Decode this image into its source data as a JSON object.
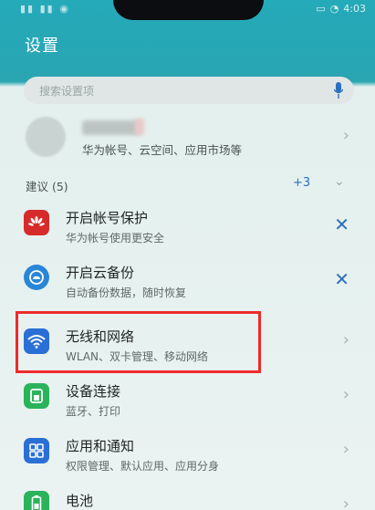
{
  "status": {
    "time": "4:03"
  },
  "header": {
    "title": "设置"
  },
  "search": {
    "placeholder": "搜索设置项"
  },
  "account": {
    "subtitle": "华为帐号、云空间、应用市场等"
  },
  "suggestions": {
    "label": "建议 (5)",
    "count": "+3"
  },
  "rows": [
    {
      "title": "开启帐号保护",
      "subtitle": "华为帐号使用更安全",
      "icon": "huawei-icon",
      "action": "close"
    },
    {
      "title": "开启云备份",
      "subtitle": "自动备份数据，随时恢复",
      "icon": "cloud-backup-icon",
      "action": "close"
    },
    {
      "title": "无线和网络",
      "subtitle": "WLAN、双卡管理、移动网络",
      "icon": "wifi-icon",
      "action": "chevron"
    },
    {
      "title": "设备连接",
      "subtitle": "蓝牙、打印",
      "icon": "device-connection-icon",
      "action": "chevron"
    },
    {
      "title": "应用和通知",
      "subtitle": "权限管理、默认应用、应用分身",
      "icon": "apps-icon",
      "action": "chevron"
    },
    {
      "title": "电池",
      "subtitle": "",
      "icon": "battery-icon",
      "action": "chevron"
    }
  ],
  "colors": {
    "header": "#24aab9",
    "accent": "#2c6fbf",
    "highlight": "#ee2a2a"
  }
}
